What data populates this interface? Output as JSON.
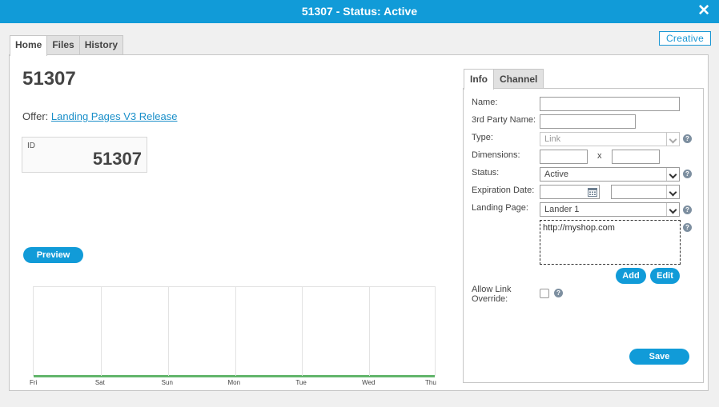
{
  "window": {
    "title": "51307 - Status: Active",
    "close_symbol": "✕"
  },
  "creative_button": "Creative",
  "tabs": [
    {
      "label": "Home",
      "active": true
    },
    {
      "label": "Files",
      "active": false
    },
    {
      "label": "History",
      "active": false
    }
  ],
  "home": {
    "heading": "51307",
    "offer_label": "Offer:",
    "offer_link": "Landing Pages V3 Release",
    "id_card": {
      "label": "ID",
      "value": "51307"
    },
    "preview_button": "Preview"
  },
  "chart_data": {
    "type": "line",
    "categories": [
      "Fri",
      "Sat",
      "Sun",
      "Mon",
      "Tue",
      "Wed",
      "Thu"
    ],
    "series": [
      {
        "values": [
          0,
          0,
          0,
          0,
          0,
          0,
          0
        ],
        "color": "#62b56b"
      }
    ],
    "grid": true
  },
  "side_tabs": [
    {
      "label": "Info",
      "active": true
    },
    {
      "label": "Channel",
      "active": false
    }
  ],
  "form": {
    "name_label": "Name:",
    "name_value": "",
    "third_party_label": "3rd Party Name:",
    "third_party_value": "",
    "type_label": "Type:",
    "type_value": "Link",
    "dimensions_label": "Dimensions:",
    "dimensions_separator": "x",
    "width_value": "",
    "height_value": "",
    "status_label": "Status:",
    "status_value": "Active",
    "expiration_label": "Expiration Date:",
    "expiration_date_value": "",
    "expiration_time_value": "",
    "landing_page_label": "Landing Page:",
    "landing_page_value": "Lander 1",
    "url_value": "http://myshop.com",
    "add_button": "Add",
    "edit_button": "Edit",
    "allow_override_label_line1": "Allow Link",
    "allow_override_label_line2": "Override:",
    "allow_override_checked": false,
    "save_button": "Save",
    "help_symbol": "?"
  },
  "colors": {
    "accent": "#119bd8",
    "chart_line": "#62b56b",
    "link": "#1a8fc9"
  }
}
